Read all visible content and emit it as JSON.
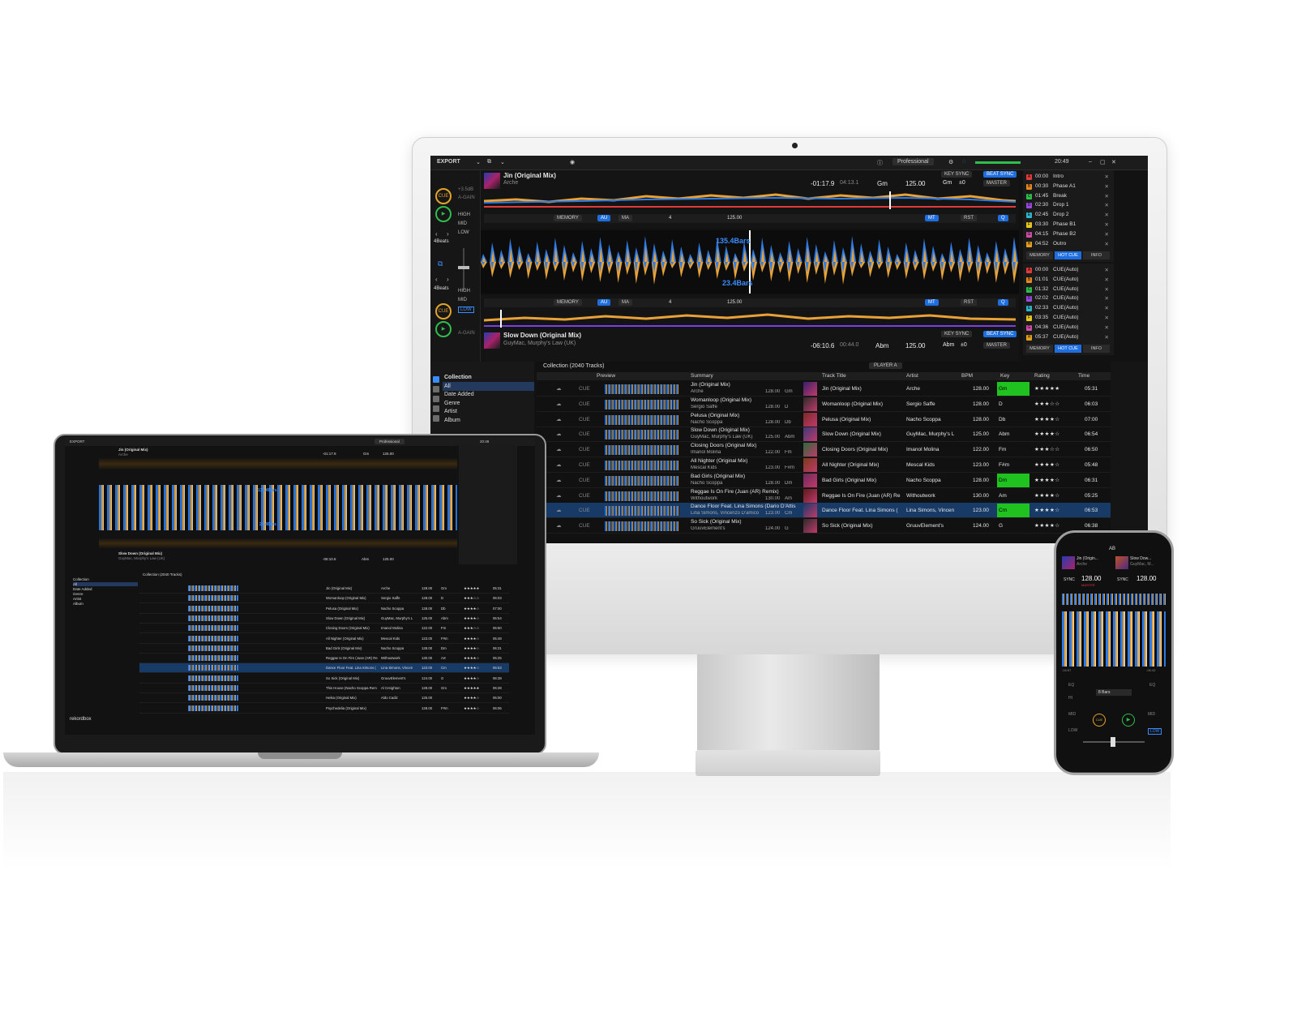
{
  "app": {
    "mode": "EXPORT",
    "plan": "Professional",
    "clock": "20:49",
    "brand": "rekordbox"
  },
  "deck1": {
    "title": "Jin (Original Mix)",
    "artist": "Arche",
    "elapsed": "-01:17.9",
    "total": "04:13.1",
    "key": "Gm",
    "bpm": "125.00",
    "key_adj": "Gm",
    "key_offset": "±0",
    "key_sync": "KEY SYNC",
    "beat_sync": "BEAT SYNC",
    "master": "MASTER",
    "gain_top": "+3.5dB",
    "gain_label": "A-GAIN",
    "bars": "135.4Bars"
  },
  "deck2": {
    "title": "Slow Down (Original Mix)",
    "artist": "GuyMac, Murphy's Law (UK)",
    "elapsed": "-06:10.6",
    "total": "00:44.0",
    "key": "Abm",
    "bpm": "125.00",
    "key_adj": "Abm",
    "key_offset": "±0",
    "key_sync": "KEY SYNC",
    "beat_sync": "BEAT SYNC",
    "master": "MASTER",
    "gain_label": "A-GAIN",
    "bars": "23.4Bars"
  },
  "transport": {
    "cue": "CUE",
    "play": "▶",
    "beats": "4Beats",
    "memory": "MEMORY",
    "au": "AU",
    "ma": "MA",
    "loop": "4",
    "tempo": "125.00",
    "mt": "MT",
    "rst": "RST",
    "q": "Q"
  },
  "eq": {
    "high": "HIGH",
    "mid": "MID",
    "low": "LOW"
  },
  "hotcues1": [
    {
      "letter": "A",
      "time": "00:00",
      "name": "Intro",
      "color": "#e23b3b"
    },
    {
      "letter": "B",
      "time": "00:30",
      "name": "Phase A1",
      "color": "#e68a1f"
    },
    {
      "letter": "C",
      "time": "01:45",
      "name": "Break",
      "color": "#2fbd4b"
    },
    {
      "letter": "D",
      "time": "02:30",
      "name": "Drop 1",
      "color": "#9a49e0"
    },
    {
      "letter": "E",
      "time": "02:45",
      "name": "Drop 2",
      "color": "#31b3c9"
    },
    {
      "letter": "F",
      "time": "03:30",
      "name": "Phase B1",
      "color": "#e6c81f"
    },
    {
      "letter": "G",
      "time": "04:15",
      "name": "Phase B2",
      "color": "#d04fa8"
    },
    {
      "letter": "H",
      "time": "04:52",
      "name": "Outro",
      "color": "#e6a11f"
    }
  ],
  "hotcues2": [
    {
      "letter": "A",
      "time": "00:00",
      "name": "CUE(Auto)",
      "color": "#e23b3b"
    },
    {
      "letter": "B",
      "time": "01:01",
      "name": "CUE(Auto)",
      "color": "#e68a1f"
    },
    {
      "letter": "C",
      "time": "01:32",
      "name": "CUE(Auto)",
      "color": "#2fbd4b"
    },
    {
      "letter": "D",
      "time": "02:02",
      "name": "CUE(Auto)",
      "color": "#9a49e0"
    },
    {
      "letter": "E",
      "time": "02:33",
      "name": "CUE(Auto)",
      "color": "#31b3c9"
    },
    {
      "letter": "F",
      "time": "03:35",
      "name": "CUE(Auto)",
      "color": "#e6c81f"
    },
    {
      "letter": "G",
      "time": "04:36",
      "name": "CUE(Auto)",
      "color": "#d04fa8"
    },
    {
      "letter": "H",
      "time": "05:37",
      "name": "CUE(Auto)",
      "color": "#e6a11f"
    }
  ],
  "cue_tabs": {
    "memory": "MEMORY",
    "hot_cue": "HOT CUE",
    "info": "INFO"
  },
  "browser": {
    "collection_header": "Collection (2040 Tracks)",
    "player": "PLAYER A",
    "tree": [
      "Collection",
      "All",
      "Date Added",
      "Genre",
      "Artist",
      "Album"
    ],
    "columns": [
      "Preview",
      "Summary",
      "Track Title",
      "Artist",
      "BPM",
      "Key",
      "Rating",
      "Time"
    ],
    "tracks": [
      {
        "title": "Jin (Original Mix)",
        "artist": "Arche",
        "bpm": "128.00",
        "key": "Gm",
        "rating": "★★★★★",
        "time": "05:31",
        "key_color": "#1fc21f"
      },
      {
        "title": "Womanloop (Original Mix)",
        "artist": "Sergio Saffe",
        "bpm": "128.00",
        "key": "D",
        "rating": "★★★☆☆",
        "time": "06:03",
        "key_color": ""
      },
      {
        "title": "Pelusa (Original Mix)",
        "artist": "Nacho Scoppa",
        "bpm": "128.00",
        "key": "Db",
        "rating": "★★★★☆",
        "time": "07:00",
        "key_color": ""
      },
      {
        "title": "Slow Down (Original Mix)",
        "artist": "GuyMac, Murphy's L",
        "summary_artist": "GuyMac, Murphy's Law (UK)",
        "bpm": "125.00",
        "key": "Abm",
        "rating": "★★★★☆",
        "time": "06:54",
        "key_color": ""
      },
      {
        "title": "Closing Doors (Original Mix)",
        "artist": "Imanol Molina",
        "bpm": "122.00",
        "key": "Fm",
        "rating": "★★★☆☆",
        "time": "06:50",
        "key_color": ""
      },
      {
        "title": "All Nighter (Original Mix)",
        "artist": "Mescal Kids",
        "bpm": "123.00",
        "key": "F#m",
        "rating": "★★★★☆",
        "time": "05:48",
        "key_color": ""
      },
      {
        "title": "Bad Girls (Original Mix)",
        "artist": "Nacho Scoppa",
        "bpm": "128.00",
        "key": "Dm",
        "rating": "★★★★☆",
        "time": "06:31",
        "key_color": "#1fc21f"
      },
      {
        "title": "Reggae Is On Fire (Juan (AR) Re",
        "summary_title": "Reggae Is On Fire (Juan (AR) Remix)",
        "artist": "Withoutwork",
        "bpm": "130.00",
        "key": "Am",
        "rating": "★★★★☆",
        "time": "05:25",
        "key_color": ""
      },
      {
        "title": "Dance Floor Feat. Lina Simons (",
        "summary_title": "Dance Floor Feat. Lina Simons (Dario D'Attis",
        "artist": "Lina Simons, Vincen",
        "summary_artist": "Lina Simons, Vincenzo D'amico",
        "bpm": "123.00",
        "key": "Cm",
        "rating": "★★★★☆",
        "time": "06:53",
        "key_color": "#1fc21f",
        "selected": true
      },
      {
        "title": "So Sick (Original Mix)",
        "artist": "GruuvElement's",
        "bpm": "124.00",
        "key": "G",
        "rating": "★★★★☆",
        "time": "06:38",
        "key_color": ""
      }
    ],
    "cue_label": "CUE"
  },
  "laptop_extra_tracks": [
    {
      "title": "This House (Nacho Scoppa Rem",
      "artist": "Al Creighton",
      "bpm": "128.00",
      "key": "Gm",
      "rating": "★★★★★",
      "time": "06:28"
    },
    {
      "title": "Heika (Original Mix)",
      "artist": "Aldo Cadiz",
      "bpm": "125.00",
      "key": "",
      "rating": "★★★★☆",
      "time": "06:00"
    },
    {
      "title": "Psychedelia (Original Mix)",
      "artist": "",
      "bpm": "128.00",
      "key": "F#m",
      "rating": "★★★★☆",
      "time": "06:06"
    }
  ],
  "phone": {
    "ab": "AB",
    "deck1_title": "Jin (Origin...",
    "deck1_artist": "Arche",
    "deck2_title": "Slow Dow...",
    "deck2_artist": "GuyMac, M...",
    "sync": "SYNC",
    "bpm1": "128.00",
    "bpm2": "128.00",
    "master": "MASTER",
    "bars": "8 Bars",
    "eq": "EQ",
    "hi": "HI",
    "mid": "MID",
    "low": "LOW",
    "cue": "CUE",
    "left_time": "-04:57",
    "right_time": "-06:43"
  }
}
